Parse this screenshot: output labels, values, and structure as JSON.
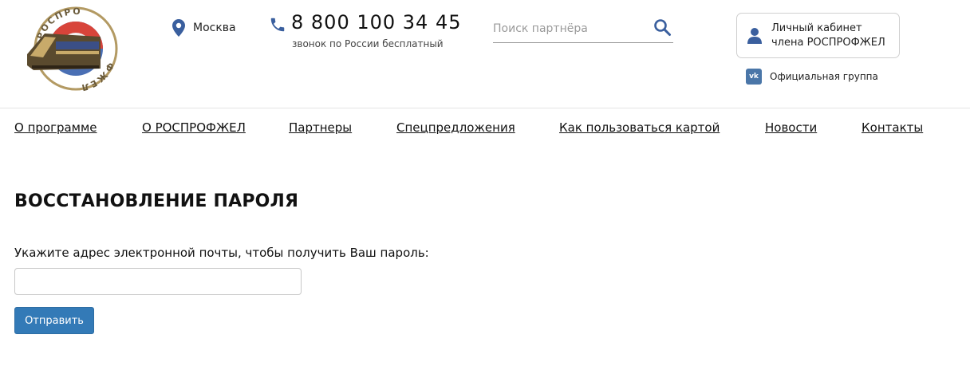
{
  "header": {
    "logo_text": "РОСПРОФЖЕЛ",
    "city": "Москва",
    "phone": "8 800 100 34 45",
    "phone_note": "звонок по России бесплатный",
    "search_placeholder": "Поиск партнёра",
    "cabinet_line1": "Личный кабинет",
    "cabinet_line2": "члена РОСПРОФЖЕЛ",
    "vk_label": "Официальная группа"
  },
  "nav": {
    "items": [
      {
        "label": "О программе"
      },
      {
        "label": "О РОСПРОФЖЕЛ"
      },
      {
        "label": "Партнеры"
      },
      {
        "label": "Спецпредложения"
      },
      {
        "label": "Как пользоваться картой"
      },
      {
        "label": "Новости"
      },
      {
        "label": "Контакты"
      }
    ]
  },
  "main": {
    "title": "ВОССТАНОВЛЕНИЕ ПАРОЛЯ",
    "prompt": "Укажите адрес электронной почты, чтобы получить Ваш пароль:",
    "email_value": "",
    "submit_label": "Отправить"
  },
  "colors": {
    "accent": "#337ab7",
    "icon_blue": "#3a5f9e",
    "vk_blue": "#4a76a8",
    "logo_gold": "#b39a63"
  }
}
